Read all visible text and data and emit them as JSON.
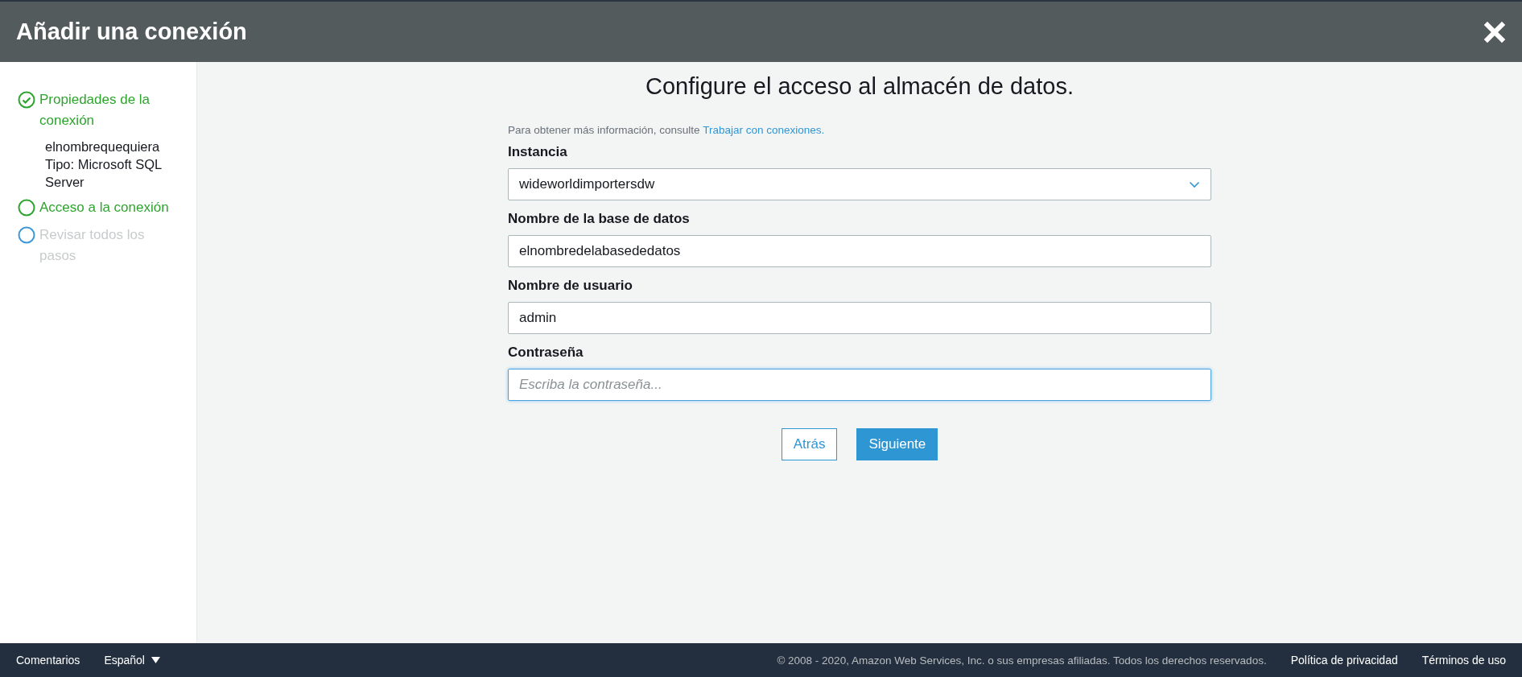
{
  "window": {
    "title": "Añadir una conexión"
  },
  "steps": [
    {
      "label": "Propiedades de la conexión",
      "completed": true,
      "disabled": false,
      "details": [
        "elnombrequequiera",
        "Tipo: Microsoft SQL Server"
      ]
    },
    {
      "label": "Acceso a la conexión",
      "completed": false,
      "disabled": false
    },
    {
      "label": "Revisar todos los pasos",
      "completed": false,
      "disabled": true
    }
  ],
  "form": {
    "title": "Configure el acceso al almacén de datos.",
    "help": "Para obtener más información, consulte",
    "help_link": "Trabajar con conexiones.",
    "fields": [
      {
        "kind": "select",
        "label": "Instancia",
        "value": "wideworldimportersdw",
        "focused": false
      },
      {
        "kind": "text",
        "label": "Nombre de la base de datos",
        "value": "elnombredelabasededatos",
        "focused": false
      },
      {
        "kind": "text",
        "label": "Nombre de usuario",
        "value": "admin",
        "focused": false
      },
      {
        "kind": "password",
        "label": "Contraseña",
        "placeholder": "Escriba la contraseña...",
        "focused": true
      }
    ],
    "buttons": [
      {
        "label": "Atrás",
        "kind": "secondary"
      },
      {
        "label": "Siguiente",
        "kind": "primary"
      }
    ]
  },
  "footer": {
    "left": [
      "Comentarios"
    ],
    "language": "Español",
    "copyright": "© 2008 - 2020, Amazon Web Services, Inc. o sus empresas afiliadas. Todos los derechos reservados.",
    "links": [
      "Política de privacidad",
      "Términos de uso"
    ]
  }
}
